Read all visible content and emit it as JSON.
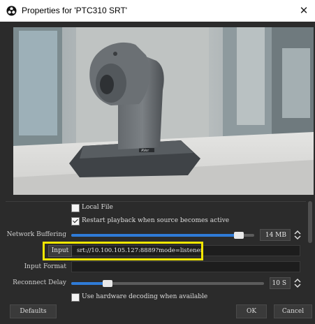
{
  "window": {
    "title": "Properties for 'PTC310 SRT'",
    "close_symbol": "✕"
  },
  "preview": {
    "camera_brand": "AVer"
  },
  "options": {
    "local_file": {
      "label": "Local File",
      "checked": false
    },
    "restart_playback": {
      "label": "Restart playback when source becomes active",
      "checked": true
    },
    "hardware_decoding": {
      "label": "Use hardware decoding when available",
      "checked": false
    }
  },
  "network_buffering": {
    "label": "Network Buffering",
    "value": "14 MB",
    "level": 0.94
  },
  "input": {
    "label": "Input",
    "value": "srt://10.100.105.127:8889?mode=listener"
  },
  "input_format": {
    "label": "Input Format",
    "value": ""
  },
  "reconnect_delay": {
    "label": "Reconnect Delay",
    "value": "10 S",
    "level": 0.17
  },
  "buttons": {
    "defaults": "Defaults",
    "ok": "OK",
    "cancel": "Cancel"
  },
  "colors": {
    "highlight": "#f2e600",
    "slider_fill": "#2f7bd7",
    "background": "#2b2b2b"
  }
}
